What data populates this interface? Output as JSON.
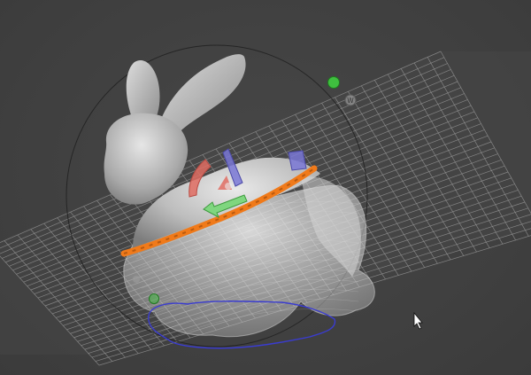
{
  "viewport": {
    "background_color": "#424242",
    "grid_color": "#9a9a9a",
    "mesh_color": "#c8c8c8",
    "cut_edge_color": "#f07a1a",
    "outline_color": "#3a3ccf"
  },
  "gizmo": {
    "world_axis_label": "W",
    "rotate_x_color": "#e06d63",
    "rotate_y_color": "#7fd67f",
    "rotate_z_color": "#7a78d6",
    "sphere_handle_color": "#3fbf3f"
  },
  "cursor": {
    "icon": "arrow-cursor-icon"
  }
}
